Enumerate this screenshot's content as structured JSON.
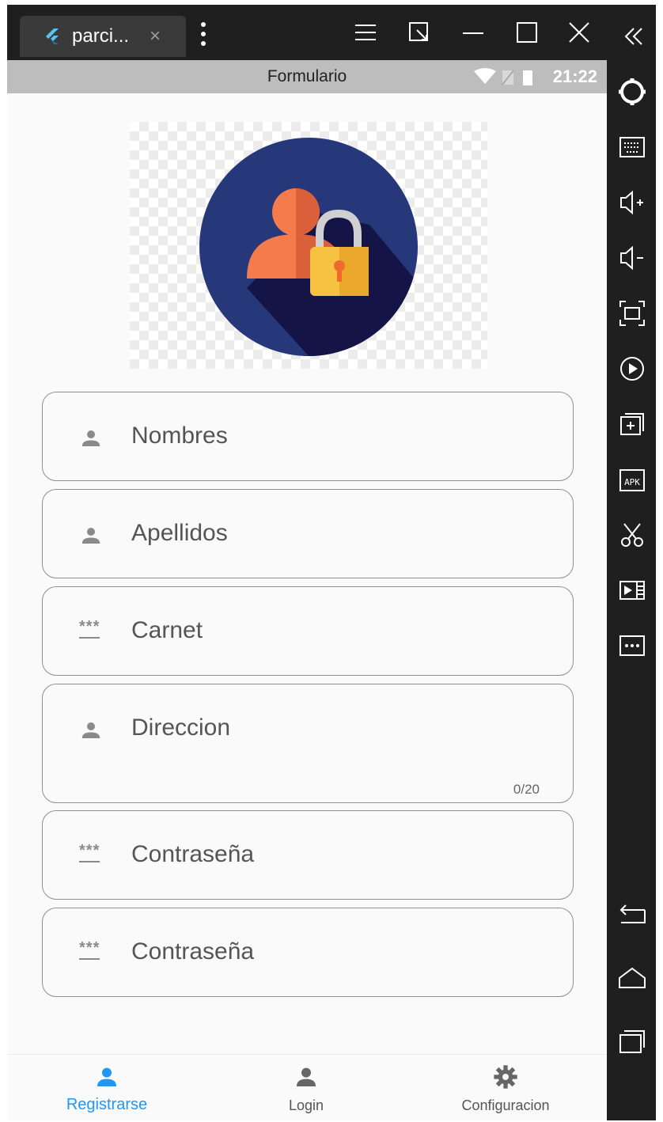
{
  "window": {
    "tab_title": "parci...",
    "tab_close": "×"
  },
  "statusbar": {
    "title": "Formulario",
    "time": "21:22"
  },
  "form": {
    "fields": [
      {
        "label": "Nombres",
        "icon": "person-icon"
      },
      {
        "label": "Apellidos",
        "icon": "person-icon"
      },
      {
        "label": "Carnet",
        "icon": "password-icon"
      },
      {
        "label": "Direccion",
        "icon": "person-icon",
        "counter": "0/20"
      },
      {
        "label": "Contraseña",
        "icon": "password-icon"
      },
      {
        "label": "Contraseña",
        "icon": "password-icon"
      }
    ],
    "password_glyph": "***"
  },
  "bottom_nav": {
    "items": [
      {
        "label": "Registrarse",
        "icon": "person-icon",
        "active": true
      },
      {
        "label": "Login",
        "icon": "person-icon",
        "active": false
      },
      {
        "label": "Configuracion",
        "icon": "gear-icon",
        "active": false
      }
    ]
  },
  "colors": {
    "accent": "#2196f3",
    "logo_circle": "#27387a",
    "logo_shadow": "#141446",
    "person": "#f47c4c",
    "lock": "#f7c142"
  },
  "sidebar_icons": [
    "collapse-icon",
    "settings-icon",
    "keyboard-icon",
    "volume-up-icon",
    "volume-down-icon",
    "fullscreen-icon",
    "record-icon",
    "add-window-icon",
    "apk-icon",
    "scissors-icon",
    "video-icon",
    "more-icon",
    "back-icon",
    "home-icon",
    "recents-icon"
  ]
}
